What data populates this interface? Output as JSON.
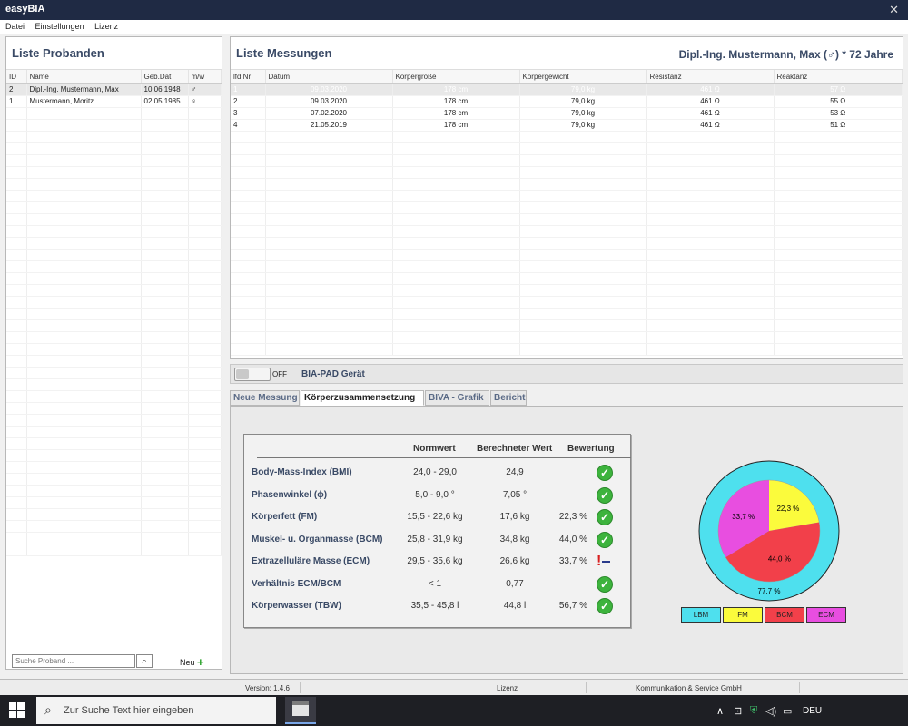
{
  "app": {
    "title": "easyBIA",
    "close_glyph": "✕"
  },
  "menu": [
    "Datei",
    "Einstellungen",
    "Lizenz"
  ],
  "left": {
    "title": "Liste Probanden",
    "columns": [
      "ID",
      "Name",
      "Geb.Dat",
      "m/w"
    ],
    "rows": [
      {
        "id": "2",
        "name": "Dipl.-Ing. Mustermann, Max",
        "dob": "10.06.1948",
        "sex": "♂"
      },
      {
        "id": "1",
        "name": "Mustermann, Moritz",
        "dob": "02.05.1985",
        "sex": "♀"
      }
    ],
    "search_placeholder": "Suche Proband ...",
    "search_icon": "search-icon",
    "new_label": "Neu",
    "new_icon": "plus-icon"
  },
  "right": {
    "title": "Liste Messungen",
    "person": "Dipl.-Ing. Mustermann, Max (♂) * 72 Jahre",
    "columns": [
      "lfd.Nr",
      "Datum",
      "Körpergröße",
      "Körpergewicht",
      "Resistanz",
      "Reaktanz"
    ],
    "rows": [
      [
        "1",
        "09.03.2020",
        "178 cm",
        "79,0 kg",
        "461 Ω",
        "57 Ω"
      ],
      [
        "2",
        "09.03.2020",
        "178 cm",
        "79,0 kg",
        "461 Ω",
        "55 Ω"
      ],
      [
        "3",
        "07.02.2020",
        "178 cm",
        "79,0 kg",
        "461 Ω",
        "53 Ω"
      ],
      [
        "4",
        "21.05.2019",
        "178 cm",
        "79,0 kg",
        "461 Ω",
        "51 Ω"
      ]
    ]
  },
  "device": {
    "toggle": "OFF",
    "label": "BIA-PAD Gerät"
  },
  "tabs": [
    "Neue Messung",
    "Körperzusammensetzung",
    "BIVA - Grafik",
    "Bericht"
  ],
  "composition": {
    "headers": {
      "norm": "Normwert",
      "calc": "Berechneter Wert",
      "eval": "Bewertung"
    },
    "rows": [
      {
        "name": "Body-Mass-Index (BMI)",
        "norm": "24,0 - 29,0",
        "calc": "24,9",
        "pct": "",
        "status": "ok"
      },
      {
        "name": "Phasenwinkel (ϕ)",
        "norm": "5,0 - 9,0 °",
        "calc": "7,05 °",
        "pct": "",
        "status": "ok"
      },
      {
        "name": "Körperfett (FM)",
        "norm": "15,5 - 22,6 kg",
        "calc": "17,6 kg",
        "pct": "22,3 %",
        "status": "ok"
      },
      {
        "name": "Muskel- u. Organmasse (BCM)",
        "norm": "25,8 - 31,9 kg",
        "calc": "34,8 kg",
        "pct": "44,0 %",
        "status": "ok"
      },
      {
        "name": "Extrazelluläre Masse (ECM)",
        "norm": "29,5 - 35,6 kg",
        "calc": "26,6 kg",
        "pct": "33,7 %",
        "status": "warn"
      },
      {
        "name": "Verhältnis ECM/BCM",
        "norm": "< 1",
        "calc": "0,77",
        "pct": "",
        "status": "ok"
      },
      {
        "name": "Körperwasser (TBW)",
        "norm": "35,5 - 45,8 l",
        "calc": "44,8 l",
        "pct": "56,7 %",
        "status": "ok"
      }
    ],
    "ok_glyph": "✓",
    "warn_glyph": "!"
  },
  "chart_data": {
    "type": "pie",
    "outer": {
      "name": "LBM",
      "value": 77.7,
      "label": "77,7 %",
      "color": "#4ee0ee"
    },
    "inner": [
      {
        "name": "FM",
        "value": 22.3,
        "label": "22,3 %",
        "color": "#fbfb3c"
      },
      {
        "name": "BCM",
        "value": 44.0,
        "label": "44,0 %",
        "color": "#f2404a"
      },
      {
        "name": "ECM",
        "value": 33.7,
        "label": "33,7 %",
        "color": "#e84ee0"
      }
    ],
    "legend": [
      "LBM",
      "FM",
      "BCM",
      "ECM"
    ]
  },
  "status": {
    "version": "Version: 1.4.6",
    "license": "Lizenz",
    "company": "Kommunikation & Service GmbH"
  },
  "taskbar": {
    "search_placeholder": "Zur Suche Text hier eingeben",
    "lang": "DEU",
    "tray_icons": [
      "chevron-up-icon",
      "meet-now-icon",
      "security-shield-icon",
      "speaker-icon",
      "network-icon"
    ]
  }
}
